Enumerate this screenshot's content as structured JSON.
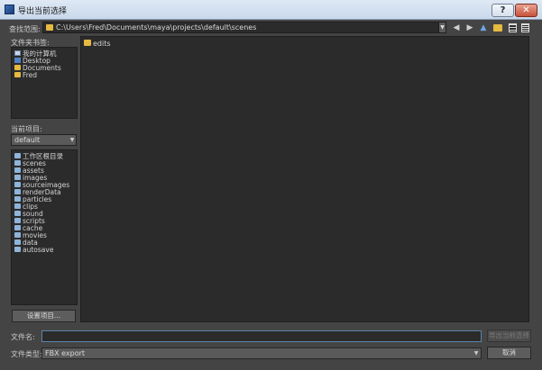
{
  "window": {
    "title": "导出当前选择",
    "help_label": "?",
    "close_label": "✕"
  },
  "lookin": {
    "label": "查找范围:",
    "path": "C:\\Users\\Fred\\Documents\\maya\\projects\\default\\scenes"
  },
  "bookmarks": {
    "label": "文件夹书签:",
    "items": [
      {
        "label": "我的计算机",
        "icon": "computer-icon"
      },
      {
        "label": "Desktop",
        "icon": "desktop-icon"
      },
      {
        "label": "Documents",
        "icon": "folder-icon"
      },
      {
        "label": "Fred",
        "icon": "folder-icon"
      }
    ]
  },
  "project": {
    "label": "当前项目:",
    "selected": "default",
    "folders": [
      "工作区根目录",
      "scenes",
      "assets",
      "images",
      "sourceimages",
      "renderData",
      "particles",
      "clips",
      "sound",
      "scripts",
      "cache",
      "movies",
      "data",
      "autosave"
    ],
    "set_project_label": "设置项目..."
  },
  "file_list": {
    "items": [
      {
        "label": "edits",
        "icon": "folder-icon"
      }
    ]
  },
  "filename": {
    "label": "文件名:",
    "value": ""
  },
  "filetype": {
    "label": "文件类型:",
    "selected": "FBX export"
  },
  "buttons": {
    "export_label": "导出当前选择",
    "cancel_label": "取消"
  },
  "colors": {
    "background": "#444444",
    "panel": "#2b2b2b",
    "folder_yellow": "#e6b941",
    "focus_border": "#5c84aa"
  }
}
